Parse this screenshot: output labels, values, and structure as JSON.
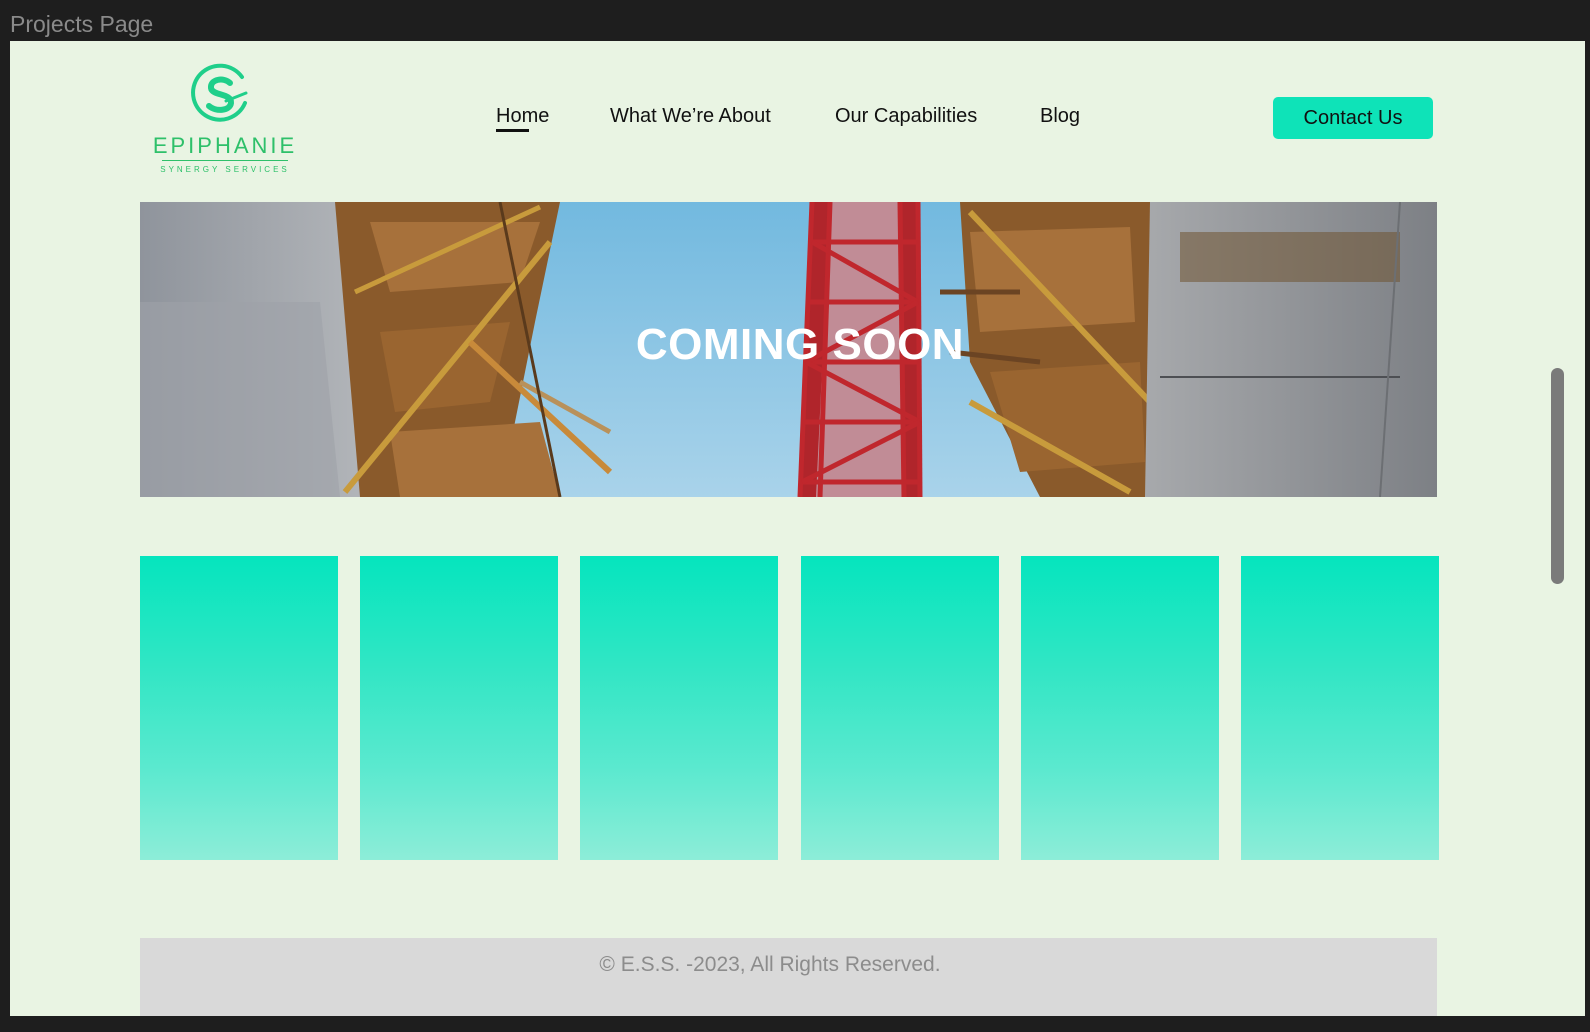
{
  "frame": {
    "title": "Projects Page"
  },
  "logo": {
    "name": "EPIPHANIE",
    "tagline": "SYNERGY SERVICES",
    "letter": "S"
  },
  "nav": {
    "items": [
      {
        "label": "Home",
        "active": true
      },
      {
        "label": "What We’re About"
      },
      {
        "label": "Our Capabilities"
      },
      {
        "label": "Blog"
      }
    ],
    "cta_label": "Contact Us"
  },
  "hero": {
    "heading": "COMING SOON"
  },
  "cards": {
    "count": 6
  },
  "footer": {
    "copyright": "© E.S.S. -2023, All Rights Reserved."
  },
  "colors": {
    "page_bg": "#e9f4e3",
    "accent": "#0ee3b8",
    "logo_green": "#2ec06a",
    "footer_bg": "#d9d9d9"
  }
}
